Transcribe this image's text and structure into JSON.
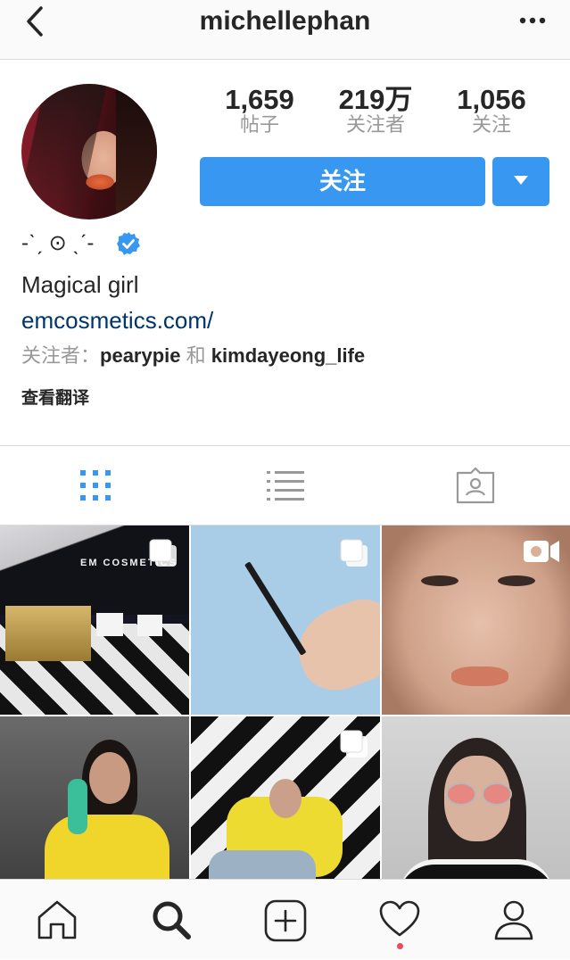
{
  "header": {
    "title": "michellephan",
    "back_icon": "chevron-left-icon",
    "more_icon": "more-horizontal-icon"
  },
  "profile": {
    "avatar": "profile-avatar-photo",
    "stats": [
      {
        "value": "1,659",
        "label": "帖子"
      },
      {
        "value": "219万",
        "label": "关注者"
      },
      {
        "value": "1,056",
        "label": "关注"
      }
    ],
    "follow_label": "关注",
    "name": "-ˋˏ ⊙ ˎˊ-",
    "verified": true,
    "bio": "Magical girl",
    "link": "emcosmetics.com/",
    "followed_by_prefix": "关注者：",
    "followed_by_user1": "pearypie",
    "followed_by_and": "和",
    "followed_by_user2": "kimdayeong_life",
    "translate_label": "查看翻译"
  },
  "tabs": [
    {
      "icon": "grid-icon",
      "active": true
    },
    {
      "icon": "list-icon",
      "active": false
    },
    {
      "icon": "tagged-icon",
      "active": false
    }
  ],
  "posts": [
    {
      "alt": "EM Cosmetics store with checkered floor",
      "brand_text": "EM COSMETICS",
      "badge": "multi-photo-icon"
    },
    {
      "alt": "Hand holding pencil on blue background",
      "badge": "multi-photo-icon"
    },
    {
      "alt": "Close-up makeup portrait",
      "badge": "video-icon"
    },
    {
      "alt": "Woman in yellow jacket with green phone",
      "badge": ""
    },
    {
      "alt": "Woman in yellow jacket on checkered floor",
      "badge": "multi-photo-icon"
    },
    {
      "alt": "Portrait with pink sunglasses",
      "badge": ""
    }
  ],
  "colors": {
    "accent": "#3897f0",
    "link": "#003569",
    "muted": "#999999",
    "notification": "#ed4956"
  },
  "bottom_nav": [
    {
      "icon": "home-icon"
    },
    {
      "icon": "search-icon",
      "active": true
    },
    {
      "icon": "add-post-icon"
    },
    {
      "icon": "heart-icon",
      "has_notification": true
    },
    {
      "icon": "profile-icon"
    }
  ]
}
